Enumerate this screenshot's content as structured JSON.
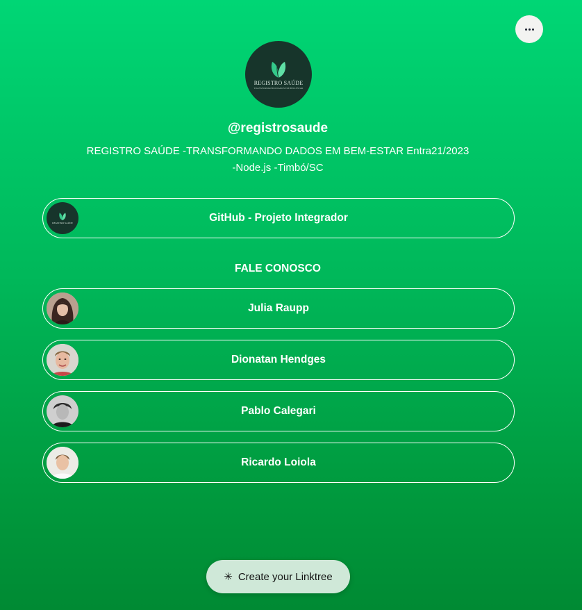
{
  "header": {
    "menu_icon": "more-horizontal-icon"
  },
  "profile": {
    "logo_text": "REGISTRO SAÚDE",
    "logo_subtext": "TRANSFORMANDO DADOS EM BEM-ESTAR",
    "username": "@registrosaude",
    "bio_line1": "REGISTRO SAÚDE -TRANSFORMANDO DADOS EM BEM-ESTAR Entra21/2023",
    "bio_line2": "-Node.js -Timbó/SC"
  },
  "links": [
    {
      "label": "GitHub - Projeto Integrador",
      "thumbnail": "registro-saude-logo"
    }
  ],
  "section": {
    "title": "FALE CONOSCO"
  },
  "contacts": [
    {
      "label": "Julia Raupp",
      "thumbnail": "person-photo"
    },
    {
      "label": "Dionatan Hendges",
      "thumbnail": "person-photo"
    },
    {
      "label": "Pablo Calegari",
      "thumbnail": "person-photo"
    },
    {
      "label": "Ricardo Loiola",
      "thumbnail": "person-photo"
    }
  ],
  "footer": {
    "create_label": "Create your Linktree",
    "create_icon": "linktree-asterisk-icon"
  },
  "colors": {
    "bg_top": "#00d675",
    "bg_bottom": "#008a33",
    "logo_bg": "#17352b",
    "button_border": "#ffffff",
    "cta_bg": "#cfe8d8"
  }
}
